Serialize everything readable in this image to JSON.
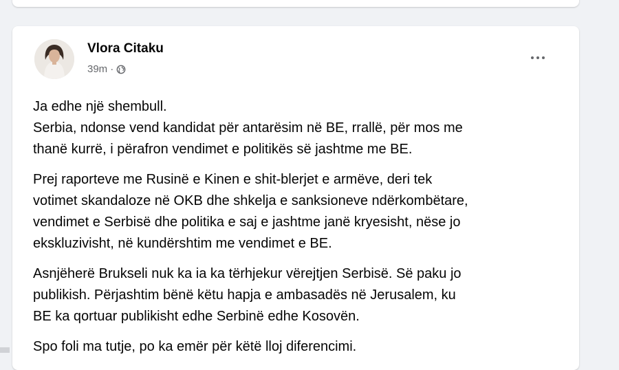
{
  "post": {
    "author": "Vlora Citaku",
    "time": "39m",
    "separator": "·",
    "privacy_icon": "globe-icon",
    "more_icon": "more-horizontal-icon",
    "paragraphs": [
      [
        "Ja edhe një shembull.",
        "Serbia, ndonse vend kandidat për antarësim në BE, rrallë, për mos me",
        "thanë kurrë, i përafron vendimet e politikës së jashtme me BE."
      ],
      [
        "Prej raporteve me Rusinë e Kinen e shit-blerjet e armëve, deri tek",
        "votimet skandaloze në OKB dhe shkelja e sanksioneve ndërkombëtare,",
        "vendimet e Serbisë dhe politika e saj e jashtme janë kryesisht, nëse jo",
        "ekskluzivisht, në kundërshtim me vendimet e BE."
      ],
      [
        "Asnjëherë Brukseli nuk ka ia ka tërhjekur vërejtjen Serbisë. Së paku jo",
        "publikish. Përjashtim bënë këtu hapja e ambasadës në Jerusalem, ku",
        "BE ka qortuar publikisht edhe Serbinë edhe Kosovën."
      ],
      [
        "Spo foli ma tutje, po ka emër për këtë lloj diferencimi."
      ]
    ]
  },
  "colors": {
    "background": "#f0f2f5",
    "card": "#ffffff",
    "text_primary": "#050505",
    "text_secondary": "#65676b"
  }
}
